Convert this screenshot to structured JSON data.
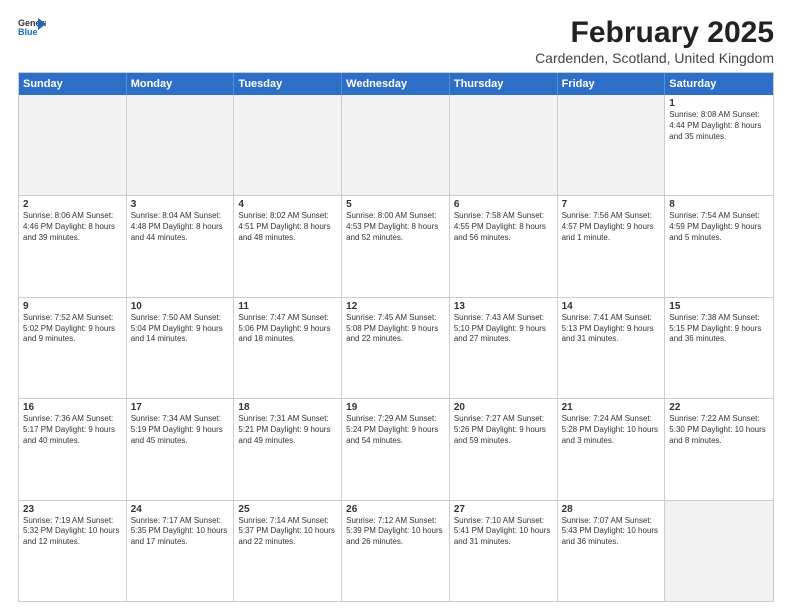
{
  "logo": {
    "general": "General",
    "blue": "Blue"
  },
  "title": "February 2025",
  "subtitle": "Cardenden, Scotland, United Kingdom",
  "header_days": [
    "Sunday",
    "Monday",
    "Tuesday",
    "Wednesday",
    "Thursday",
    "Friday",
    "Saturday"
  ],
  "weeks": [
    [
      {
        "day": "",
        "info": ""
      },
      {
        "day": "",
        "info": ""
      },
      {
        "day": "",
        "info": ""
      },
      {
        "day": "",
        "info": ""
      },
      {
        "day": "",
        "info": ""
      },
      {
        "day": "",
        "info": ""
      },
      {
        "day": "1",
        "info": "Sunrise: 8:08 AM\nSunset: 4:44 PM\nDaylight: 8 hours and 35 minutes."
      }
    ],
    [
      {
        "day": "2",
        "info": "Sunrise: 8:06 AM\nSunset: 4:46 PM\nDaylight: 8 hours and 39 minutes."
      },
      {
        "day": "3",
        "info": "Sunrise: 8:04 AM\nSunset: 4:48 PM\nDaylight: 8 hours and 44 minutes."
      },
      {
        "day": "4",
        "info": "Sunrise: 8:02 AM\nSunset: 4:51 PM\nDaylight: 8 hours and 48 minutes."
      },
      {
        "day": "5",
        "info": "Sunrise: 8:00 AM\nSunset: 4:53 PM\nDaylight: 8 hours and 52 minutes."
      },
      {
        "day": "6",
        "info": "Sunrise: 7:58 AM\nSunset: 4:55 PM\nDaylight: 8 hours and 56 minutes."
      },
      {
        "day": "7",
        "info": "Sunrise: 7:56 AM\nSunset: 4:57 PM\nDaylight: 9 hours and 1 minute."
      },
      {
        "day": "8",
        "info": "Sunrise: 7:54 AM\nSunset: 4:59 PM\nDaylight: 9 hours and 5 minutes."
      }
    ],
    [
      {
        "day": "9",
        "info": "Sunrise: 7:52 AM\nSunset: 5:02 PM\nDaylight: 9 hours and 9 minutes."
      },
      {
        "day": "10",
        "info": "Sunrise: 7:50 AM\nSunset: 5:04 PM\nDaylight: 9 hours and 14 minutes."
      },
      {
        "day": "11",
        "info": "Sunrise: 7:47 AM\nSunset: 5:06 PM\nDaylight: 9 hours and 18 minutes."
      },
      {
        "day": "12",
        "info": "Sunrise: 7:45 AM\nSunset: 5:08 PM\nDaylight: 9 hours and 22 minutes."
      },
      {
        "day": "13",
        "info": "Sunrise: 7:43 AM\nSunset: 5:10 PM\nDaylight: 9 hours and 27 minutes."
      },
      {
        "day": "14",
        "info": "Sunrise: 7:41 AM\nSunset: 5:13 PM\nDaylight: 9 hours and 31 minutes."
      },
      {
        "day": "15",
        "info": "Sunrise: 7:38 AM\nSunset: 5:15 PM\nDaylight: 9 hours and 36 minutes."
      }
    ],
    [
      {
        "day": "16",
        "info": "Sunrise: 7:36 AM\nSunset: 5:17 PM\nDaylight: 9 hours and 40 minutes."
      },
      {
        "day": "17",
        "info": "Sunrise: 7:34 AM\nSunset: 5:19 PM\nDaylight: 9 hours and 45 minutes."
      },
      {
        "day": "18",
        "info": "Sunrise: 7:31 AM\nSunset: 5:21 PM\nDaylight: 9 hours and 49 minutes."
      },
      {
        "day": "19",
        "info": "Sunrise: 7:29 AM\nSunset: 5:24 PM\nDaylight: 9 hours and 54 minutes."
      },
      {
        "day": "20",
        "info": "Sunrise: 7:27 AM\nSunset: 5:26 PM\nDaylight: 9 hours and 59 minutes."
      },
      {
        "day": "21",
        "info": "Sunrise: 7:24 AM\nSunset: 5:28 PM\nDaylight: 10 hours and 3 minutes."
      },
      {
        "day": "22",
        "info": "Sunrise: 7:22 AM\nSunset: 5:30 PM\nDaylight: 10 hours and 8 minutes."
      }
    ],
    [
      {
        "day": "23",
        "info": "Sunrise: 7:19 AM\nSunset: 5:32 PM\nDaylight: 10 hours and 12 minutes."
      },
      {
        "day": "24",
        "info": "Sunrise: 7:17 AM\nSunset: 5:35 PM\nDaylight: 10 hours and 17 minutes."
      },
      {
        "day": "25",
        "info": "Sunrise: 7:14 AM\nSunset: 5:37 PM\nDaylight: 10 hours and 22 minutes."
      },
      {
        "day": "26",
        "info": "Sunrise: 7:12 AM\nSunset: 5:39 PM\nDaylight: 10 hours and 26 minutes."
      },
      {
        "day": "27",
        "info": "Sunrise: 7:10 AM\nSunset: 5:41 PM\nDaylight: 10 hours and 31 minutes."
      },
      {
        "day": "28",
        "info": "Sunrise: 7:07 AM\nSunset: 5:43 PM\nDaylight: 10 hours and 36 minutes."
      },
      {
        "day": "",
        "info": ""
      }
    ]
  ]
}
